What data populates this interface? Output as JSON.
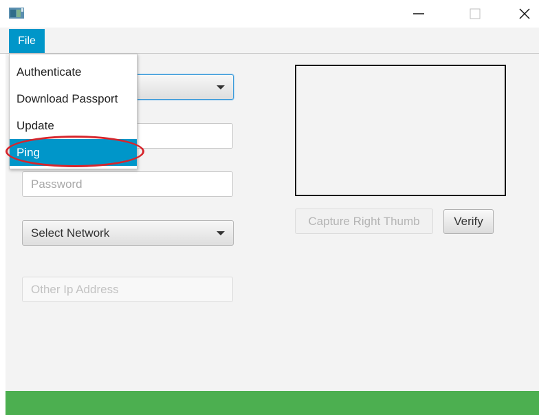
{
  "window": {
    "controls": {
      "minimize_icon": "minimize-icon",
      "maximize_icon": "maximize-icon",
      "close_icon": "close-icon"
    }
  },
  "menubar": {
    "file_label": "File"
  },
  "file_menu": {
    "items": [
      {
        "label": "Authenticate",
        "selected": false
      },
      {
        "label": "Download Passport",
        "selected": false
      },
      {
        "label": "Update",
        "selected": false
      },
      {
        "label": "Ping",
        "selected": true
      }
    ]
  },
  "form": {
    "top_combo_value": "",
    "username_value": "",
    "password_placeholder": "Password",
    "network_combo_value": "Select Network",
    "other_ip_placeholder": "Other Ip Address"
  },
  "fingerprint": {
    "capture_button_label": "Capture Right Thumb",
    "verify_button_label": "Verify"
  },
  "colors": {
    "accent": "#0096c9",
    "status_bar": "#4caf50",
    "annotation": "#d6252c",
    "background": "#f3f3f3"
  }
}
